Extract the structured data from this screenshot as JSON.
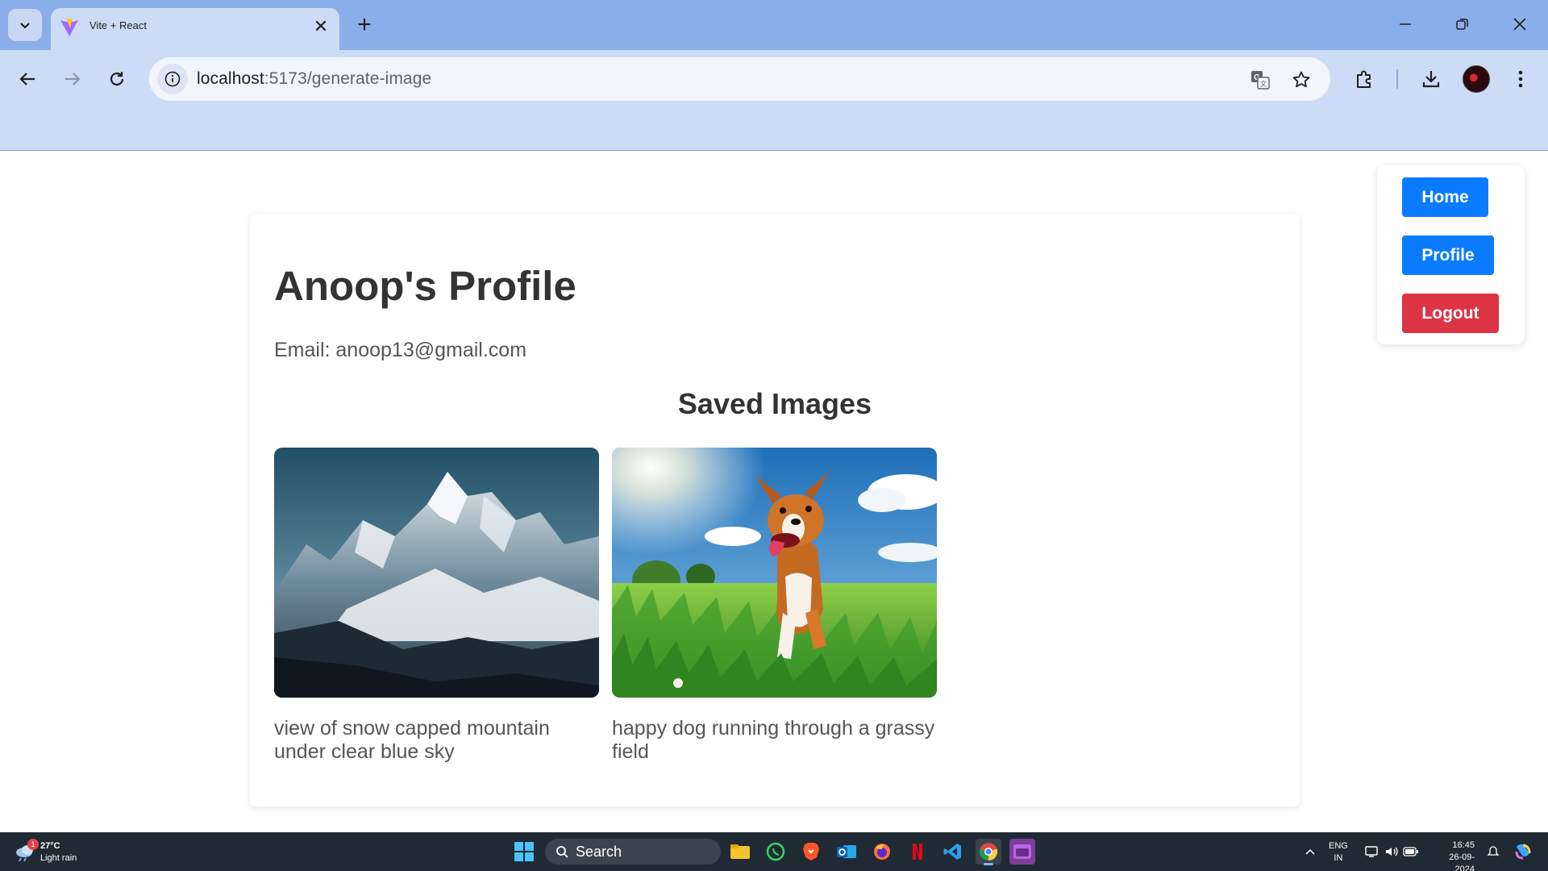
{
  "browser": {
    "tab": {
      "title": "Vite + React",
      "favicon": "vite-logo-icon"
    },
    "url": {
      "host": "localhost",
      "path": ":5173/generate-image"
    }
  },
  "page": {
    "title": "Anoop's Profile",
    "email": "Email: anoop13@gmail.com",
    "saved_title": "Saved Images",
    "images": [
      {
        "caption": "view of snow capped mountain under clear blue sky",
        "subject": "mountain"
      },
      {
        "caption": "happy dog running through a grassy field",
        "subject": "dog"
      }
    ],
    "menu": {
      "home": "Home",
      "profile": "Profile",
      "logout": "Logout"
    },
    "colors": {
      "primary": "#0a7bff",
      "danger": "#dc3545",
      "heading": "#333333",
      "text": "#555555"
    }
  },
  "taskbar": {
    "weather": {
      "temp": "27°C",
      "desc": "Light rain",
      "badge": "1"
    },
    "search": "Search",
    "lang_top": "ENG",
    "lang_bottom": "IN",
    "time": "16:45",
    "date": "26-09-2024"
  }
}
